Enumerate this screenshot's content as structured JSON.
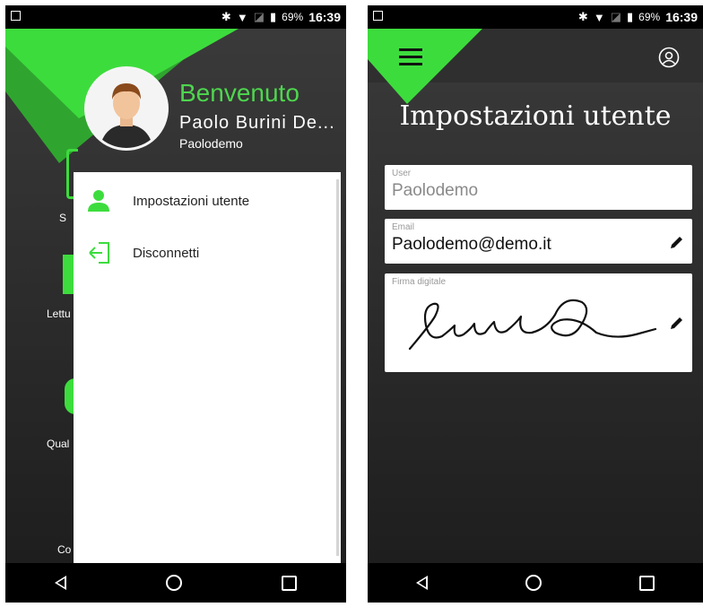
{
  "status_bar": {
    "battery": "69%",
    "time": "16:39"
  },
  "left": {
    "home_labels": [
      "S",
      "Lettu",
      "Qual",
      "Co"
    ],
    "header": {
      "welcome": "Benvenuto",
      "full_name": "Paolo Burini De...",
      "username": "Paolodemo"
    },
    "menu": [
      {
        "label": "Impostazioni utente",
        "icon": "user-icon"
      },
      {
        "label": "Disconnetti",
        "icon": "logout-icon"
      }
    ]
  },
  "right": {
    "title": "Impostazioni utente",
    "fields": {
      "user": {
        "label": "User",
        "value": "Paolodemo"
      },
      "email": {
        "label": "Email",
        "value": "Paolodemo@demo.it"
      },
      "signature": {
        "label": "Firma digitale"
      }
    }
  },
  "colors": {
    "accent": "#3ddc3d",
    "accent_dark": "#2fa52f",
    "background": "#2b2b2b"
  }
}
